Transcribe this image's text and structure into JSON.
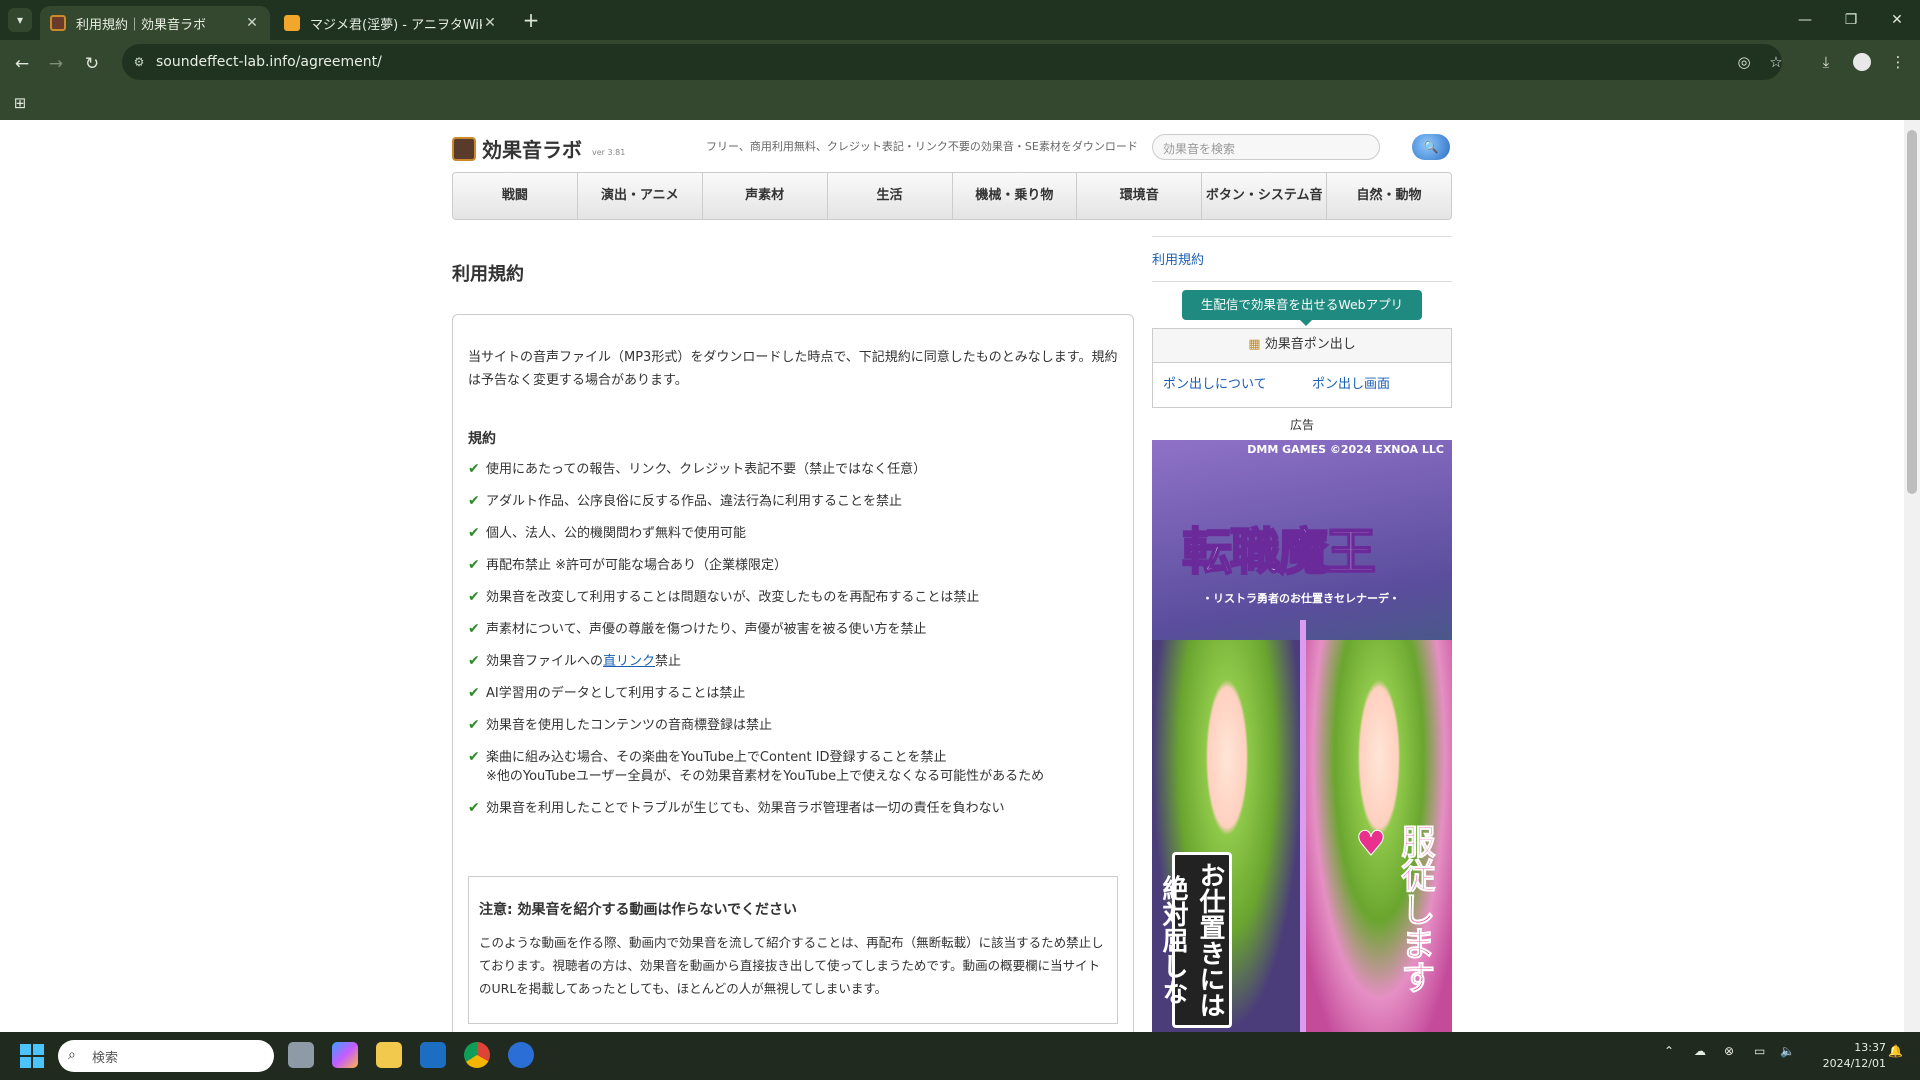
{
  "browser": {
    "tabs": [
      {
        "title": "利用規約｜効果音ラボ",
        "active": true
      },
      {
        "title": "マジメ君(淫夢) - アニヲタWiki(仮)",
        "active": false
      }
    ],
    "url": "soundeffect-lab.info/agreement/"
  },
  "site": {
    "logo_text": "効果音ラボ",
    "version": "ver 3.81",
    "tagline": "フリー、商用利用無料、クレジット表記・リンク不要の効果音・SE素材をダウンロード",
    "search_placeholder": "効果音を検索",
    "nav": [
      "戦闘",
      "演出・アニメ",
      "声素材",
      "生活",
      "機械・乗り物",
      "環境音",
      "ボタン・システム音",
      "自然・動物"
    ]
  },
  "main": {
    "page_title": "利用規約",
    "intro": "当サイトの音声ファイル（MP3形式）をダウンロードした時点で、下記規約に同意したものとみなします。規約は予告なく変更する場合があります。",
    "rules_title": "規約",
    "rules": [
      "使用にあたっての報告、リンク、クレジット表記不要（禁止ではなく任意）",
      "アダルト作品、公序良俗に反する作品、違法行為に利用することを禁止",
      "個人、法人、公的機関問わず無料で使用可能",
      "再配布禁止 ※許可が可能な場合あり（企業様限定）",
      "効果音を改変して利用することは問題ないが、改変したものを再配布することは禁止",
      "声素材について、声優の尊厳を傷つけたり、声優が被害を被る使い方を禁止"
    ],
    "rule_link": {
      "before": "効果音ファイルへの",
      "link": "直リンク",
      "after": "禁止"
    },
    "rules_after": [
      "AI学習用のデータとして利用することは禁止",
      "効果音を使用したコンテンツの音商標登録は禁止"
    ],
    "rule_youtube": {
      "line1": "楽曲に組み込む場合、その楽曲をYouTube上でContent ID登録することを禁止",
      "line2": "※他のYouTubeユーザー全員が、その効果音素材をYouTube上で使えなくなる可能性があるため"
    },
    "rule_last": "効果音を利用したことでトラブルが生じても、効果音ラボ管理者は一切の責任を負わない",
    "note_title": "注意: 効果音を紹介する動画は作らないでください",
    "note_body": "このような動画を作る際、動画内で効果音を流して紹介することは、再配布（無断転載）に該当するため禁止しております。視聴者の方は、効果音を動画から直接抜き出して使ってしまうためです。動画の概要欄に当サイトのURLを掲載してあったとしても、ほとんどの人が無視してしまいます。"
  },
  "sidebar": {
    "breadcrumb": "利用規約",
    "webapp_button": "生配信で効果音を出せるWebアプリ",
    "pon_title": "効果音ポン出し",
    "pon_links": [
      "ポン出しについて",
      "ポン出し画面"
    ],
    "ad_label": "広告",
    "ad": {
      "brand": "DMM GAMES ©2024 EXNOA LLC",
      "title": "転職魔王",
      "subtitle": "・リストラ勇者のお仕置きセレナーデ・",
      "left_text": "お仕置きには絶対屈しない！",
      "right_text": "服従します♥"
    }
  },
  "taskbar": {
    "search_placeholder": "検索",
    "time": "13:37",
    "date": "2024/12/01"
  },
  "colors": {
    "accent_link": "#1a5fb4",
    "teal": "#1f8a7f",
    "check_green": "#2e8b22",
    "chrome_bg": "#1f3320"
  }
}
